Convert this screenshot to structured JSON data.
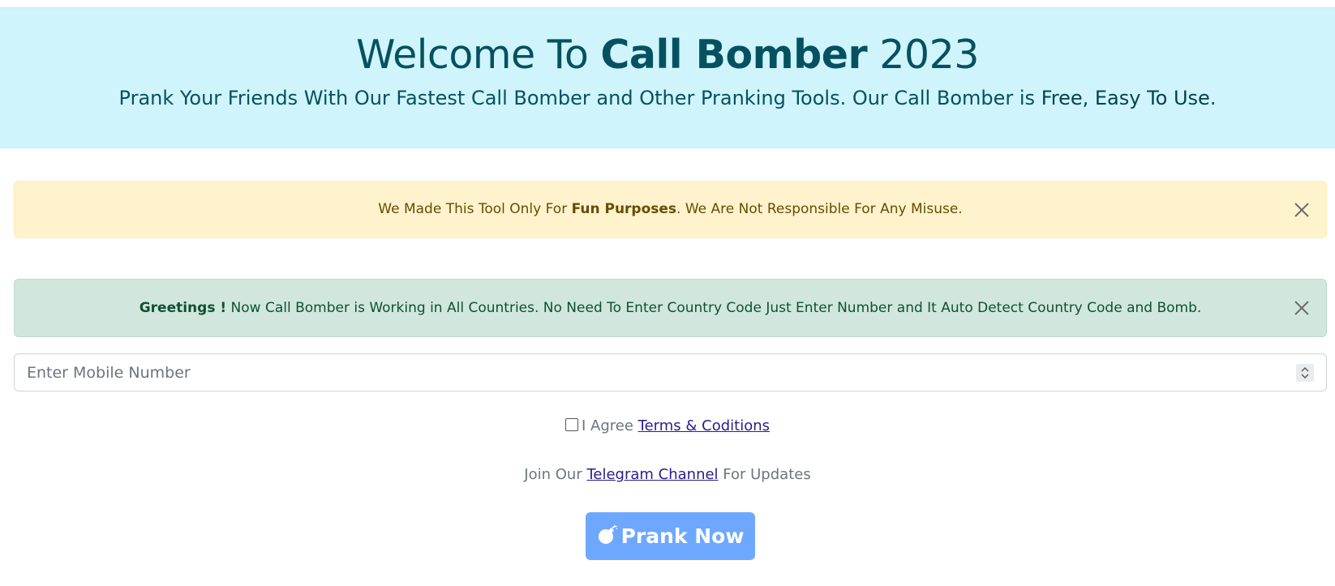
{
  "hero": {
    "title_prefix": "Welcome To ",
    "title_bold": "Call Bomber",
    "title_suffix": " 2023",
    "subtitle_prefix": "Prank Your Friends With Our Fastest Call Bomber and Other Pranking Tools. Our Call Bomber is ",
    "subtitle_highlight": "Free, Easy To Use",
    "subtitle_suffix": "."
  },
  "warning_alert": {
    "prefix": "We Made This Tool Only For ",
    "bold": "Fun Purposes",
    "suffix": ". We Are Not Responsible For Any Misuse."
  },
  "success_alert": {
    "bold": "Greetings !",
    "text": " Now Call Bomber is Working in All Countries. No Need To Enter Country Code Just Enter Number and It Auto Detect Country Code and Bomb."
  },
  "mobile_input": {
    "placeholder": "Enter Mobile Number",
    "value": ""
  },
  "agree": {
    "checked": false,
    "label": "I Agree ",
    "link": "Terms & Coditions"
  },
  "join": {
    "prefix": "Join Our ",
    "link": "Telegram Channel",
    "suffix": " For Updates"
  },
  "prank_button": {
    "label": "Prank Now",
    "icon": "bomb-icon"
  },
  "colors": {
    "hero_bg": "#cff4fc",
    "hero_text": "#055160",
    "warning_bg": "#fff3cd",
    "warning_text": "#664d03",
    "success_bg": "#d1e7dd",
    "success_text": "#0f5132",
    "button_bg": "#6ea8fe",
    "link": "#2c1c8c"
  }
}
